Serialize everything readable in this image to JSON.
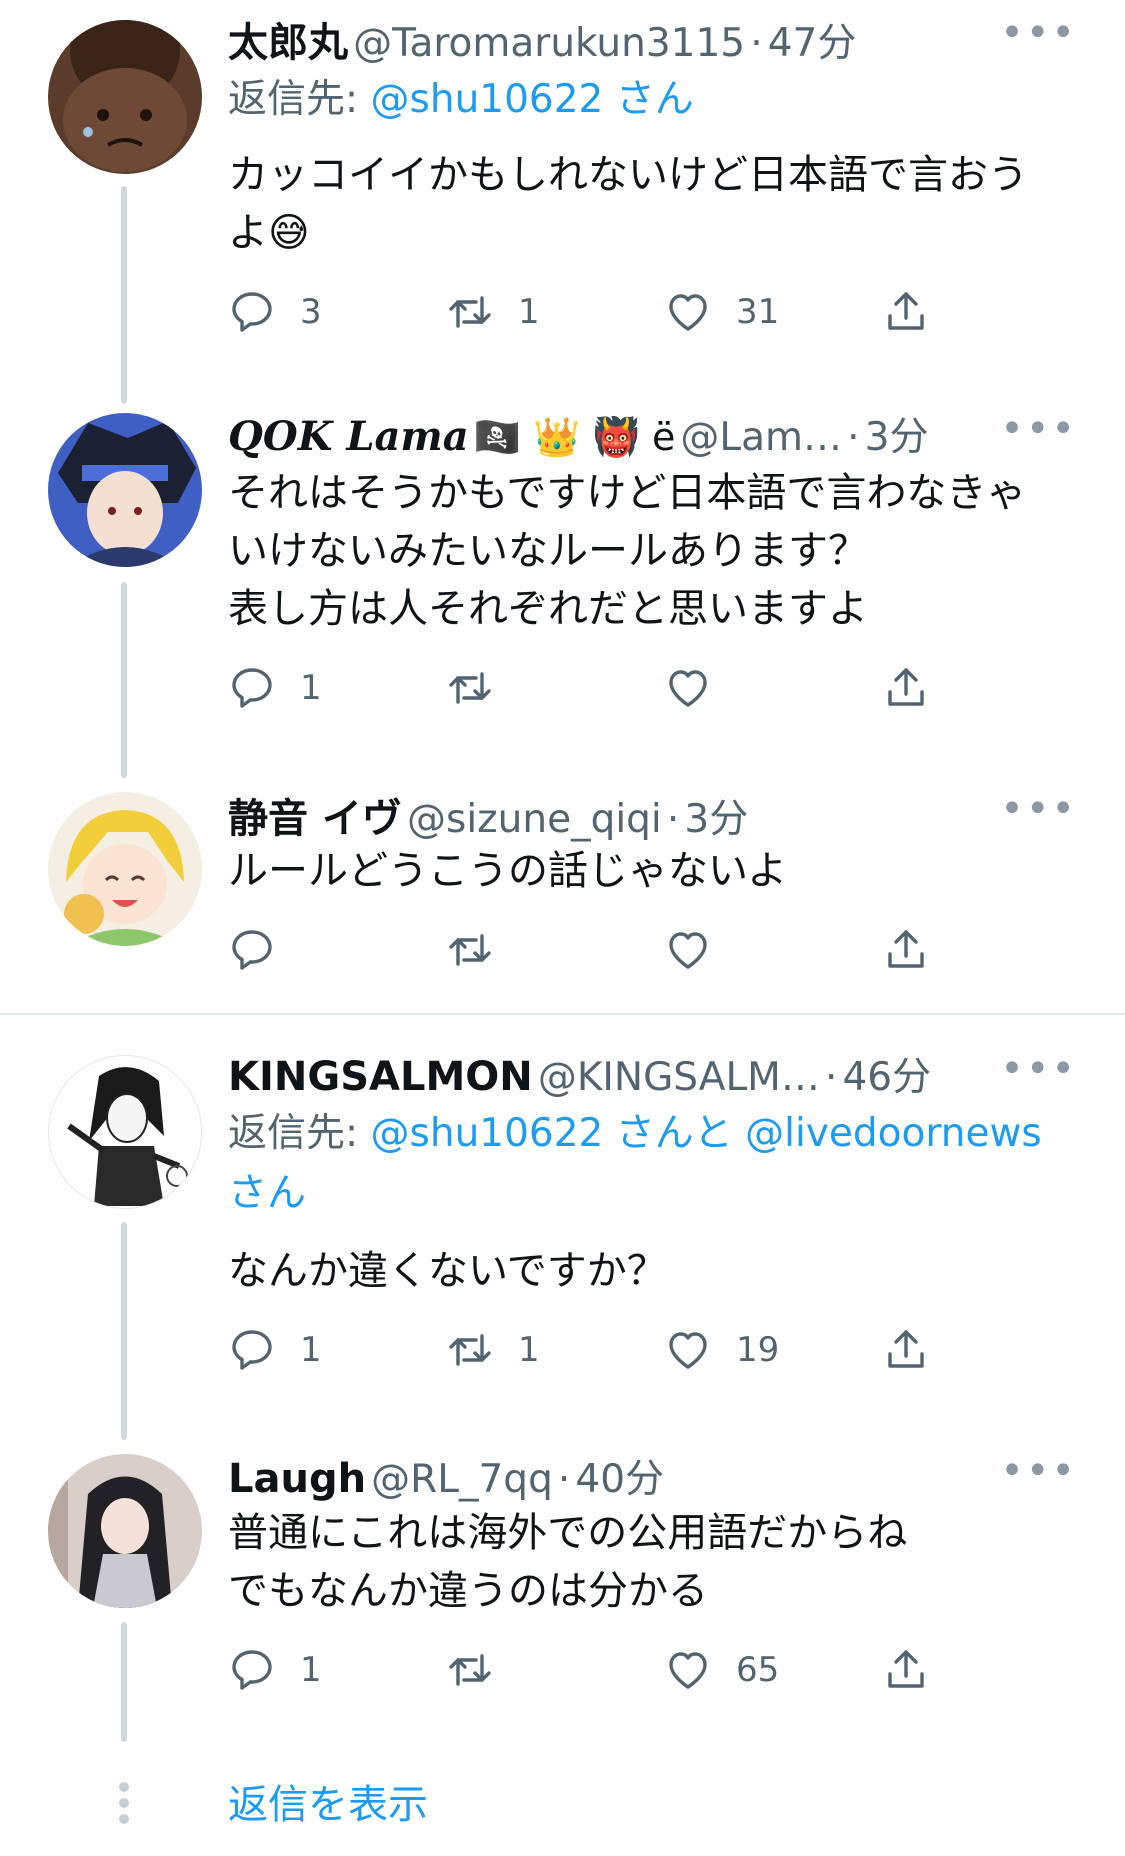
{
  "tweets": [
    {
      "name": "太郎丸",
      "handle": "@Taromarukun3115",
      "dot": "·",
      "time": "47分",
      "reply_prefix": "返信先: ",
      "reply_mention": "@shu10622 さん",
      "text_line1": "カッコイイかもしれないけど日本語で言おう",
      "text_line2": "よ",
      "emoji": "😅",
      "reply_count": "3",
      "retweet_count": "1",
      "like_count": "31"
    },
    {
      "name": "QOK Lama",
      "emojis": "🏴‍☠️ 👑 👹 ë",
      "handle": "@Lam…",
      "dot": "·",
      "time": "3分",
      "text_line1": "それはそうかもですけど日本語で言わなきゃ",
      "text_line2": "いけないみたいなルールあります？",
      "text_line3": "表し方は人それぞれだと思いますよ",
      "reply_count": "1",
      "retweet_count": "",
      "like_count": ""
    },
    {
      "name": "静音 イヴ",
      "handle": "@sizune_qiqi",
      "dot": "·",
      "time": "3分",
      "text_line1": "ルールどうこうの話じゃないよ",
      "reply_count": "",
      "retweet_count": "",
      "like_count": ""
    },
    {
      "name": "KINGSALMON",
      "handle": "@KINGSALM…",
      "dot": "·",
      "time": "46分",
      "reply_prefix": "返信先: ",
      "reply_mention1": "@shu10622 さんと",
      "reply_mention2": "@livedoornews",
      "reply_mention3": "さん",
      "text_line1": "なんか違くないですか？",
      "reply_count": "1",
      "retweet_count": "1",
      "like_count": "19"
    },
    {
      "name": "Laugh",
      "handle": "@RL_7qq",
      "dot": "·",
      "time": "40分",
      "text_line1": "普通にこれは海外での公用語だからね",
      "text_line2": "でもなんか違うのは分かる",
      "reply_count": "1",
      "retweet_count": "",
      "like_count": "65"
    }
  ],
  "more_glyph": "•••",
  "show_replies": "返信を表示",
  "icons": {
    "reply": "speech-bubble-icon",
    "retweet": "retweet-arrows-icon",
    "like": "heart-icon",
    "share": "share-upload-icon"
  },
  "colors": {
    "link": "#1d9bf0",
    "secondary": "#536471",
    "thread_line": "#cfd9de"
  }
}
